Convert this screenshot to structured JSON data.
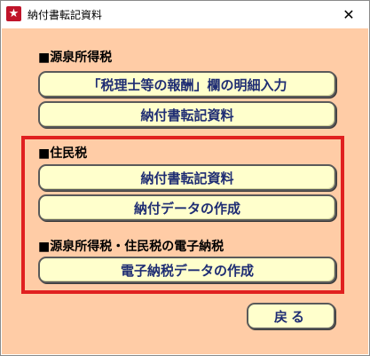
{
  "window": {
    "title": "納付書転記資料",
    "icon": "star-icon",
    "close_label": "✕"
  },
  "sections": {
    "gensen": {
      "label": "■源泉所得税",
      "buttons": [
        "「税理士等の報酬」欄の明細入力",
        "納付書転記資料"
      ]
    },
    "jumin": {
      "label": "■住民税",
      "buttons": [
        "納付書転記資料",
        "納付データの作成"
      ]
    },
    "denshi": {
      "label": "■源泉所得税・住民税の電子納税",
      "buttons": [
        "電子納税データの作成"
      ]
    }
  },
  "footer": {
    "back_label": "戻る"
  },
  "colors": {
    "client_bg": "#ffcca6",
    "button_bg": "#ffffcc",
    "button_text": "#1f2d73",
    "highlight_frame": "#e02020"
  }
}
